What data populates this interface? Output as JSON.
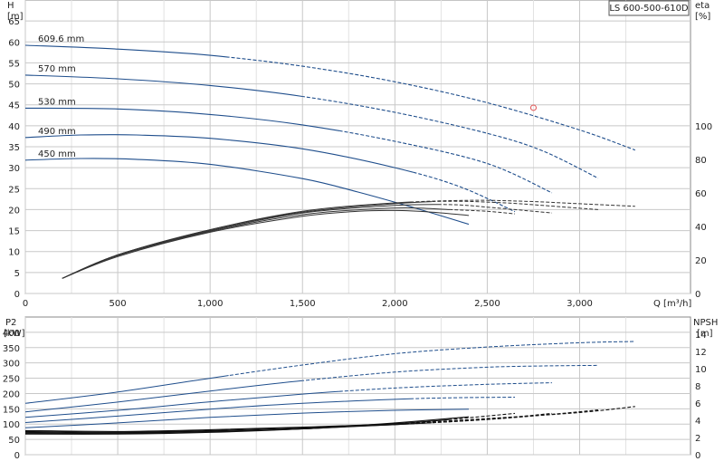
{
  "chart_data": [
    {
      "type": "line",
      "title": "LS 600-500-610D",
      "ylabel": "H",
      "ylabel_unit": "[m]",
      "y2label": "eta",
      "y2label_unit": "[%]",
      "xlabel": "Q [m³/h]",
      "xlim": [
        0,
        3600
      ],
      "ylim": [
        0,
        70
      ],
      "y2lim": [
        0,
        175
      ],
      "x_ticks": [
        0,
        500,
        1000,
        1500,
        2000,
        2500,
        3000
      ],
      "x_tick_labels": [
        "0",
        "500",
        "1,000",
        "1,500",
        "2,000",
        "2,500",
        "3,000"
      ],
      "y_ticks": [
        0,
        5,
        10,
        15,
        20,
        25,
        30,
        35,
        40,
        45,
        50,
        55,
        60,
        65
      ],
      "y2_ticks": [
        0,
        20,
        40,
        60,
        80,
        100
      ],
      "grid": true,
      "series": [
        {
          "name": "609.6 mm",
          "x": [
            0,
            500,
            1000,
            1500,
            2000,
            2500,
            3000,
            3300
          ],
          "y": [
            59.2,
            58.3,
            56.8,
            54.2,
            50.5,
            45.5,
            39.0,
            34.2
          ]
        },
        {
          "name": "570 mm",
          "x": [
            0,
            500,
            1000,
            1500,
            2000,
            2500,
            2800,
            3100
          ],
          "y": [
            52.1,
            51.2,
            49.6,
            47.0,
            43.2,
            38.2,
            34.0,
            27.5
          ]
        },
        {
          "name": "530 mm",
          "x": [
            0,
            500,
            1000,
            1500,
            2000,
            2500,
            2850
          ],
          "y": [
            44.2,
            44.0,
            42.7,
            40.2,
            36.3,
            31.0,
            24.0
          ]
        },
        {
          "name": "490 mm",
          "x": [
            0,
            300,
            600,
            1000,
            1500,
            2000,
            2350,
            2650
          ],
          "y": [
            37.2,
            37.8,
            37.8,
            37.0,
            34.5,
            30.0,
            25.5,
            19.5
          ]
        },
        {
          "name": "450 mm",
          "x": [
            0,
            300,
            600,
            1000,
            1500,
            1800,
            2100,
            2400
          ],
          "y": [
            31.8,
            32.2,
            32.0,
            30.8,
            27.4,
            24.2,
            20.5,
            16.5
          ]
        }
      ],
      "efficiency_series": [
        {
          "x": [
            200,
            500,
            1000,
            1500,
            2000,
            2400,
            2700,
            3000,
            3300
          ],
          "y": [
            9,
            23,
            38,
            49,
            54,
            55.5,
            55,
            53.5,
            52
          ]
        },
        {
          "x": [
            200,
            500,
            1000,
            1500,
            2000,
            2300,
            2600,
            2800,
            3100
          ],
          "y": [
            9,
            23,
            38,
            48.5,
            53.5,
            55,
            54,
            52.5,
            50
          ]
        },
        {
          "x": [
            200,
            500,
            1000,
            1500,
            2000,
            2300,
            2500,
            2650,
            2850
          ],
          "y": [
            9,
            23,
            37.5,
            48,
            52.5,
            53,
            51.5,
            50,
            48
          ]
        },
        {
          "x": [
            200,
            500,
            1000,
            1500,
            1900,
            2100,
            2300,
            2500,
            2650
          ],
          "y": [
            9,
            22.5,
            37,
            47,
            50.5,
            51,
            50,
            49,
            47.5
          ]
        },
        {
          "x": [
            200,
            500,
            1000,
            1500,
            1800,
            2000,
            2200,
            2400
          ],
          "y": [
            9,
            22,
            36.5,
            46,
            49,
            49.5,
            48.5,
            46.5
          ]
        }
      ],
      "duty_point": {
        "x": 2750,
        "y": 44.3
      },
      "label_positions_x": [
        70,
        70,
        70,
        70,
        70
      ]
    },
    {
      "type": "line",
      "ylabel": "P2",
      "ylabel_unit": "[kW]",
      "y2label": "NPSH",
      "y2label_unit": "[m]",
      "xlim": [
        0,
        3600
      ],
      "ylim": [
        0,
        450
      ],
      "y2lim": [
        0,
        16
      ],
      "y_ticks": [
        0,
        50,
        100,
        150,
        200,
        250,
        300,
        350,
        400
      ],
      "y2_ticks": [
        0,
        2,
        4,
        6,
        8,
        10,
        12,
        14
      ],
      "grid": true,
      "power_series": [
        {
          "x": [
            0,
            500,
            1000,
            1500,
            2000,
            2500,
            3000,
            3300
          ],
          "y": [
            168,
            205,
            250,
            293,
            330,
            352,
            366,
            370
          ]
        },
        {
          "x": [
            0,
            500,
            1000,
            1500,
            2000,
            2500,
            2800,
            3100
          ],
          "y": [
            140,
            172,
            208,
            242,
            270,
            286,
            290,
            292
          ]
        },
        {
          "x": [
            0,
            500,
            1000,
            1500,
            2000,
            2500,
            2850
          ],
          "y": [
            122,
            145,
            173,
            198,
            218,
            230,
            235
          ]
        },
        {
          "x": [
            0,
            500,
            1000,
            1500,
            2000,
            2300,
            2650
          ],
          "y": [
            105,
            126,
            149,
            168,
            181,
            186,
            188
          ]
        },
        {
          "x": [
            0,
            500,
            1000,
            1500,
            2000,
            2400
          ],
          "y": [
            88,
            104,
            122,
            136,
            145,
            149
          ]
        }
      ],
      "npsh_series": [
        {
          "x": [
            0,
            500,
            1000,
            1500,
            2000,
            2500,
            3000,
            3300
          ],
          "y": [
            2.8,
            2.7,
            2.9,
            3.2,
            3.6,
            4.2,
            4.9,
            5.6
          ]
        },
        {
          "x": [
            0,
            500,
            1000,
            1500,
            2000,
            2500,
            2800,
            3100
          ],
          "y": [
            2.7,
            2.6,
            2.8,
            3.1,
            3.5,
            4.1,
            4.6,
            5.2
          ]
        },
        {
          "x": [
            0,
            500,
            1000,
            1500,
            2000,
            2500,
            2850
          ],
          "y": [
            2.6,
            2.5,
            2.7,
            3.0,
            3.5,
            4.1,
            4.8
          ]
        },
        {
          "x": [
            0,
            500,
            1000,
            1500,
            2000,
            2300,
            2650
          ],
          "y": [
            2.5,
            2.5,
            2.7,
            3.0,
            3.6,
            4.1,
            4.8
          ]
        },
        {
          "x": [
            0,
            500,
            1000,
            1500,
            2000,
            2400
          ],
          "y": [
            2.4,
            2.4,
            2.6,
            3.0,
            3.7,
            4.4
          ]
        }
      ]
    }
  ],
  "colors": {
    "head": "#1f4e8c",
    "eff": "#333333",
    "power": "#1f4e8c",
    "npsh": "#111111",
    "grid": "#c8c8c8",
    "duty": "#e05050"
  }
}
